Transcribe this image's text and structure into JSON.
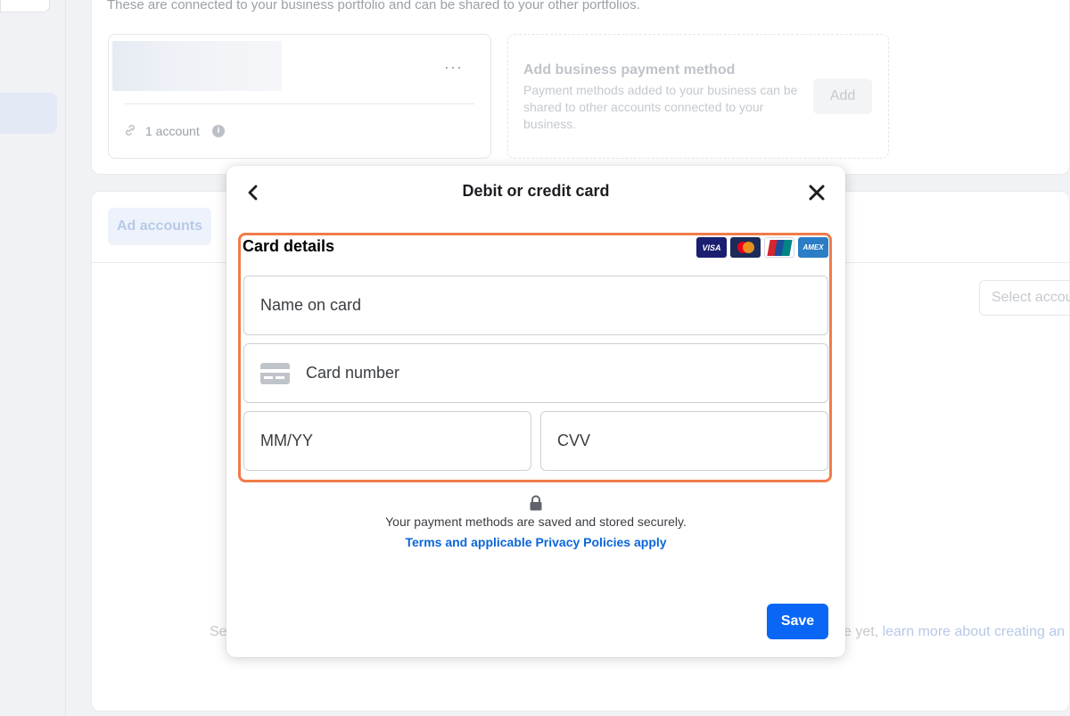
{
  "background": {
    "connected_text": "These are connected to your business portfolio and can be shared to your other portfolios.",
    "account_card": {
      "more_icon": "more-dots-icon",
      "account_count": "1 account"
    },
    "add_payment": {
      "title": "Add business payment method",
      "description": "Payment methods added to your business can be shared to other accounts connected to your business.",
      "add_label": "Add"
    },
    "tabs": {
      "ad_accounts": "Ad accounts"
    },
    "select_account_placeholder": "Select accou",
    "empty_state": {
      "left_text": "Se",
      "right_text": "e yet, ",
      "link_text": "learn more about creating an"
    }
  },
  "modal": {
    "title": "Debit or credit card",
    "back_icon": "chevron-left-icon",
    "close_icon": "close-icon",
    "card_details_label": "Card details",
    "brands": [
      "VISA",
      "Mastercard",
      "UnionPay",
      "AMEX"
    ],
    "fields": {
      "name_placeholder": "Name on card",
      "number_placeholder": "Card number",
      "expiry_placeholder": "MM/YY",
      "cvv_placeholder": "CVV"
    },
    "secure_text": "Your payment methods are saved and stored securely.",
    "terms_link": "Terms and applicable Privacy Policies apply",
    "save_label": "Save"
  },
  "colors": {
    "accent": "#0a66f5",
    "link": "#0a66d8",
    "highlight": "#f07c4a"
  }
}
